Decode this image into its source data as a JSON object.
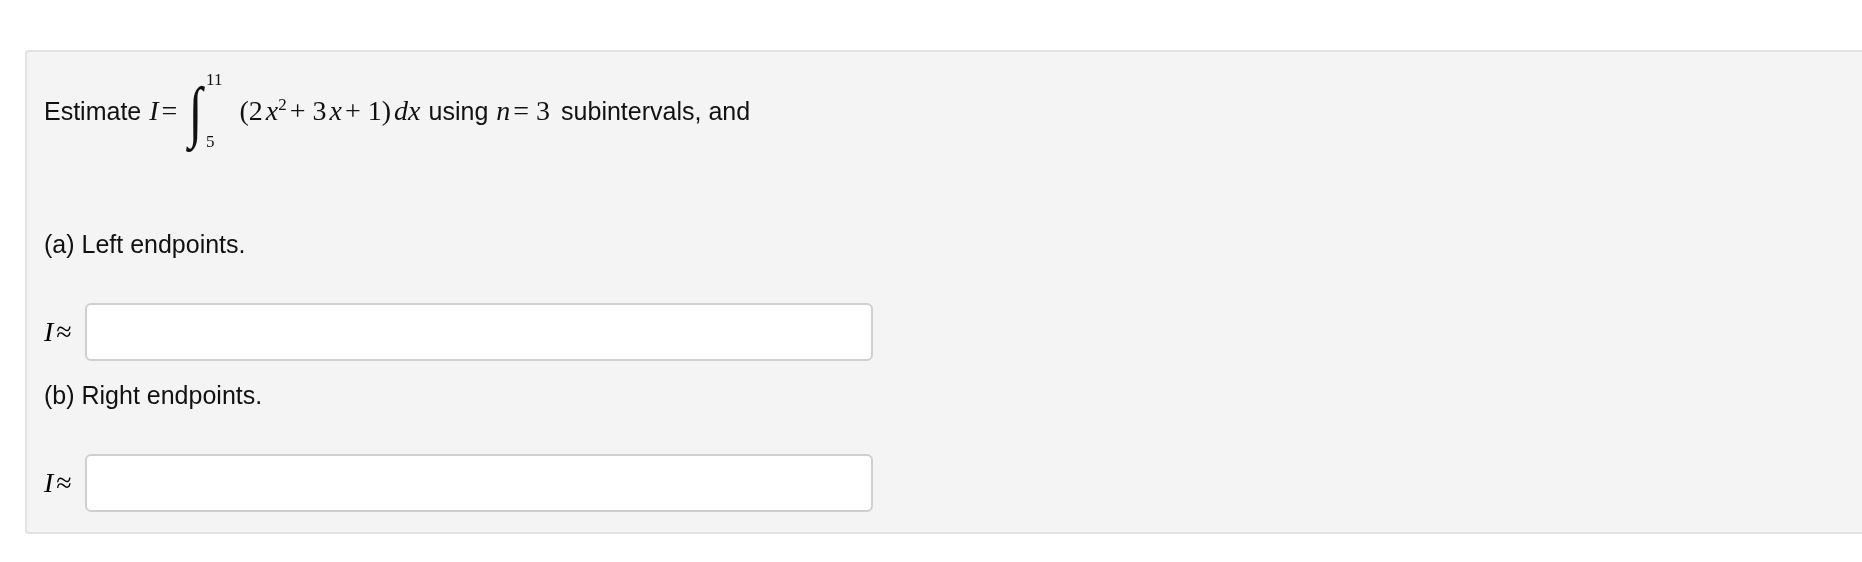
{
  "question": {
    "segments": [
      {
        "kind": "text",
        "text": "Estimate"
      },
      {
        "kind": "math",
        "tokens": [
          {
            "kind": "var",
            "text": "I"
          },
          {
            "kind": "op",
            "text": "="
          }
        ]
      },
      {
        "kind": "integral",
        "symbol": "∫",
        "lower": "5",
        "upper": "11"
      },
      {
        "kind": "math",
        "tokens": [
          {
            "kind": "op",
            "text": "(2"
          },
          {
            "kind": "var",
            "text": "x"
          },
          {
            "kind": "sup",
            "text": "2"
          },
          {
            "kind": "op",
            "text": "+ 3"
          },
          {
            "kind": "var",
            "text": "x"
          },
          {
            "kind": "op",
            "text": "+ 1)"
          },
          {
            "kind": "var",
            "text": "dx"
          }
        ]
      },
      {
        "kind": "text",
        "text": "using"
      },
      {
        "kind": "math",
        "tokens": [
          {
            "kind": "var",
            "text": "n"
          },
          {
            "kind": "op",
            "text": "= 3"
          }
        ]
      },
      {
        "kind": "text",
        "text": "subintervals, and"
      }
    ]
  },
  "parts": [
    {
      "label": "(a) Left endpoints.",
      "answer_label": [
        {
          "kind": "var",
          "text": "I"
        },
        {
          "kind": "op",
          "text": "≈"
        }
      ]
    },
    {
      "label": "(b) Right endpoints.",
      "answer_label": [
        {
          "kind": "var",
          "text": "I"
        },
        {
          "kind": "op",
          "text": "≈"
        }
      ]
    }
  ]
}
